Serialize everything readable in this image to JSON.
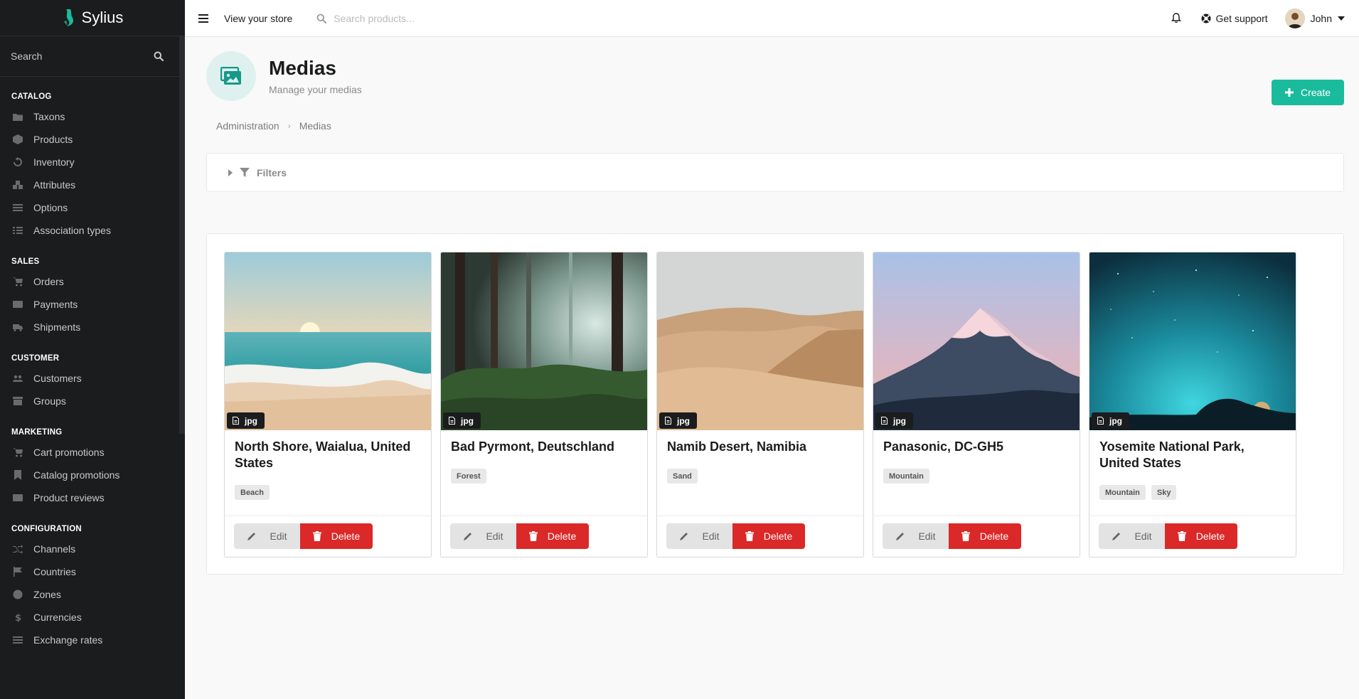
{
  "app": {
    "name": "Sylius"
  },
  "sidebar": {
    "search_placeholder": "Search",
    "sections": [
      {
        "header": "CATALOG",
        "items": [
          {
            "label": "Taxons",
            "icon": "folder-icon"
          },
          {
            "label": "Products",
            "icon": "cube-icon"
          },
          {
            "label": "Inventory",
            "icon": "history-icon"
          },
          {
            "label": "Attributes",
            "icon": "cubes-icon"
          },
          {
            "label": "Options",
            "icon": "options-icon"
          },
          {
            "label": "Association types",
            "icon": "tasks-icon"
          }
        ]
      },
      {
        "header": "SALES",
        "items": [
          {
            "label": "Orders",
            "icon": "cart-icon"
          },
          {
            "label": "Payments",
            "icon": "payment-icon"
          },
          {
            "label": "Shipments",
            "icon": "truck-icon"
          }
        ]
      },
      {
        "header": "CUSTOMER",
        "items": [
          {
            "label": "Customers",
            "icon": "users-icon"
          },
          {
            "label": "Groups",
            "icon": "archive-icon"
          }
        ]
      },
      {
        "header": "MARKETING",
        "items": [
          {
            "label": "Cart promotions",
            "icon": "cart-arrow-icon"
          },
          {
            "label": "Catalog promotions",
            "icon": "bookmark-icon"
          },
          {
            "label": "Product reviews",
            "icon": "newspaper-icon"
          }
        ]
      },
      {
        "header": "CONFIGURATION",
        "items": [
          {
            "label": "Channels",
            "icon": "random-icon"
          },
          {
            "label": "Countries",
            "icon": "flag-icon"
          },
          {
            "label": "Zones",
            "icon": "globe-icon"
          },
          {
            "label": "Currencies",
            "icon": "dollar-icon"
          },
          {
            "label": "Exchange rates",
            "icon": "exchange-icon"
          }
        ]
      }
    ]
  },
  "topbar": {
    "view_store": "View your store",
    "search_placeholder": "Search products...",
    "support": "Get support",
    "user": "John"
  },
  "page": {
    "title": "Medias",
    "subtitle": "Manage your medias",
    "create_label": "Create"
  },
  "breadcrumb": [
    "Administration",
    "Medias"
  ],
  "filters": {
    "label": "Filters"
  },
  "colors": {
    "accent": "#1abb9c",
    "danger": "#db2828",
    "sidebar": "#1b1c1d"
  },
  "medias": [
    {
      "title": "North Shore, Waialua, United States",
      "type": "jpg",
      "tags": [
        "Beach"
      ],
      "edit": "Edit",
      "delete": "Delete"
    },
    {
      "title": "Bad Pyrmont, Deutschland",
      "type": "jpg",
      "tags": [
        "Forest"
      ],
      "edit": "Edit",
      "delete": "Delete"
    },
    {
      "title": "Namib Desert, Namibia",
      "type": "jpg",
      "tags": [
        "Sand"
      ],
      "edit": "Edit",
      "delete": "Delete"
    },
    {
      "title": "Panasonic, DC-GH5",
      "type": "jpg",
      "tags": [
        "Mountain"
      ],
      "edit": "Edit",
      "delete": "Delete"
    },
    {
      "title": "Yosemite National Park, United States",
      "type": "jpg",
      "tags": [
        "Mountain",
        "Sky"
      ],
      "edit": "Edit",
      "delete": "Delete"
    }
  ]
}
